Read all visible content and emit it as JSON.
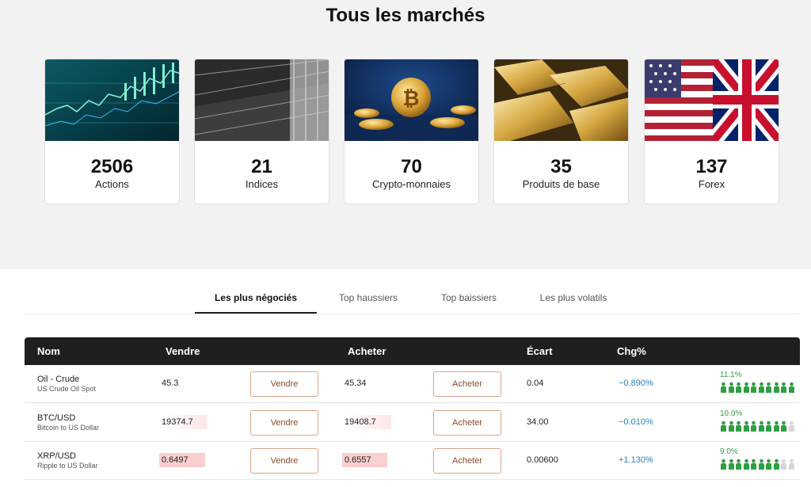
{
  "page": {
    "title": "Tous les marchés"
  },
  "markets": [
    {
      "count": "2506",
      "label": "Actions",
      "image": "stock-chart-image"
    },
    {
      "count": "21",
      "label": "Indices",
      "image": "dow-jones-sign-image"
    },
    {
      "count": "70",
      "label": "Crypto-monnaies",
      "image": "bitcoin-coins-image"
    },
    {
      "count": "35",
      "label": "Produits de base",
      "image": "gold-bars-image"
    },
    {
      "count": "137",
      "label": "Forex",
      "image": "us-uk-flags-image"
    }
  ],
  "tabs": [
    {
      "label": "Les plus négociés",
      "active": true
    },
    {
      "label": "Top haussiers",
      "active": false
    },
    {
      "label": "Top baissiers",
      "active": false
    },
    {
      "label": "Les plus volatils",
      "active": false
    }
  ],
  "table": {
    "headers": {
      "name": "Nom",
      "sell": "Vendre",
      "buy": "Acheter",
      "spread": "Écart",
      "change": "Chg%"
    },
    "sell_button": "Vendre",
    "buy_button": "Acheter",
    "rows": [
      {
        "name": "Oil - Crude",
        "subtitle": "US Crude Oil Spot",
        "sell": "45.3",
        "buy": "45.34",
        "spread": "0.04",
        "change": "−0.890%",
        "sentiment_pct": "11.1%",
        "sentiment_fraction": 1.0
      },
      {
        "name": "BTC/USD",
        "subtitle": "Bitcoin to US Dollar",
        "sell": "19374.7",
        "buy": "19408.7",
        "spread": "34.00",
        "change": "−0.010%",
        "sentiment_pct": "10.0%",
        "sentiment_fraction": 0.9
      },
      {
        "name": "XRP/USD",
        "subtitle": "Ripple to US Dollar",
        "sell": "0.6497",
        "buy": "0.6557",
        "spread": "0.00600",
        "change": "+1.130%",
        "sentiment_pct": "9.0%",
        "sentiment_fraction": 0.8
      }
    ]
  },
  "colors": {
    "accent_green": "#2f9e44",
    "change_blue": "#2a80b9",
    "button_border": "#d9a58b",
    "header_bg": "#1f1f1f",
    "price_tint": "#f9cfd0"
  }
}
